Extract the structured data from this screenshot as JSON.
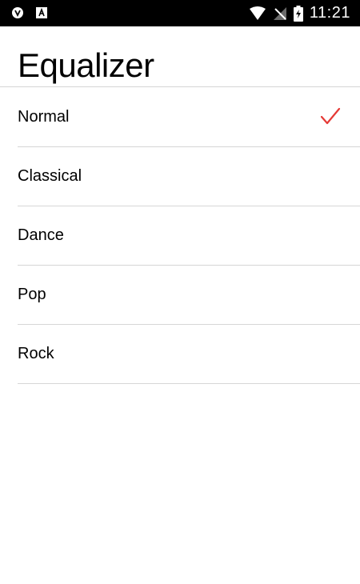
{
  "status_bar": {
    "time": "11:21",
    "icons": [
      "vpn-shield-icon",
      "a-notification-icon",
      "wifi-icon",
      "no-signal-icon",
      "battery-charging-icon"
    ]
  },
  "screen": {
    "title": "Equalizer"
  },
  "presets": [
    {
      "label": "Normal",
      "selected": true
    },
    {
      "label": "Classical",
      "selected": false
    },
    {
      "label": "Dance",
      "selected": false
    },
    {
      "label": "Pop",
      "selected": false
    },
    {
      "label": "Rock",
      "selected": false
    }
  ],
  "colors": {
    "accent": "#e53935",
    "status_bar_bg": "#000000",
    "divider": "#d6d6d6"
  }
}
